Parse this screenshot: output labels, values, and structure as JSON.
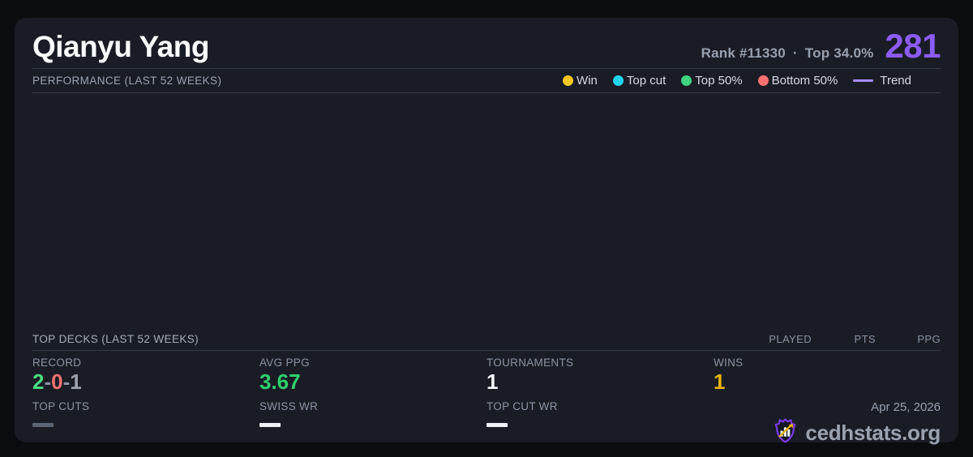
{
  "colors": {
    "page_background": "#0b0c10",
    "card_background": "#1a1c25",
    "accent_purple": "#8b5cf6",
    "win_yellow": "#f6c822",
    "top_cut_cyan": "#22d3ee",
    "top50_green": "#3fd47f",
    "bottom50_red": "#f87171",
    "trend_purple": "#a78bfa",
    "positive_green": "#4ade80",
    "ppg_green": "#2fd06e",
    "neutral_gray": "#9ca3af",
    "wins_gold": "#eab308"
  },
  "header": {
    "player_name": "Qianyu Yang",
    "rank": "Rank #11330",
    "separator": "·",
    "top_percent": "Top 34.0%",
    "points": "281"
  },
  "performance": {
    "title": "PERFORMANCE (LAST 52 WEEKS)",
    "legend": [
      {
        "label": "Win",
        "color": "#f6c822",
        "type": "dot"
      },
      {
        "label": "Top cut",
        "color": "#22d3ee",
        "type": "dot"
      },
      {
        "label": "Top 50%",
        "color": "#3fd47f",
        "type": "dot"
      },
      {
        "label": "Bottom 50%",
        "color": "#f87171",
        "type": "dot"
      },
      {
        "label": "Trend",
        "color": "#a78bfa",
        "type": "line"
      }
    ],
    "chart_empty": true
  },
  "top_decks": {
    "title": "TOP DECKS (LAST 52 WEEKS)",
    "columns": [
      "PLAYED",
      "PTS",
      "PPG"
    ],
    "rows": []
  },
  "stats": {
    "record": {
      "label": "RECORD",
      "wins": "2",
      "losses": "0",
      "draws": "1",
      "separator": "-"
    },
    "avg_ppg": {
      "label": "AVG PPG",
      "value": "3.67"
    },
    "tournaments": {
      "label": "TOURNAMENTS",
      "value": "1"
    },
    "wins": {
      "label": "WINS",
      "value": "1"
    },
    "top_cuts": {
      "label": "TOP CUTS",
      "value": "—"
    },
    "swiss_wr": {
      "label": "SWISS WR",
      "value": "—"
    },
    "top_cut_wr": {
      "label": "TOP CUT WR",
      "value": "—"
    }
  },
  "footer": {
    "date": "Apr 25, 2026",
    "site": "cedhstats.org"
  }
}
